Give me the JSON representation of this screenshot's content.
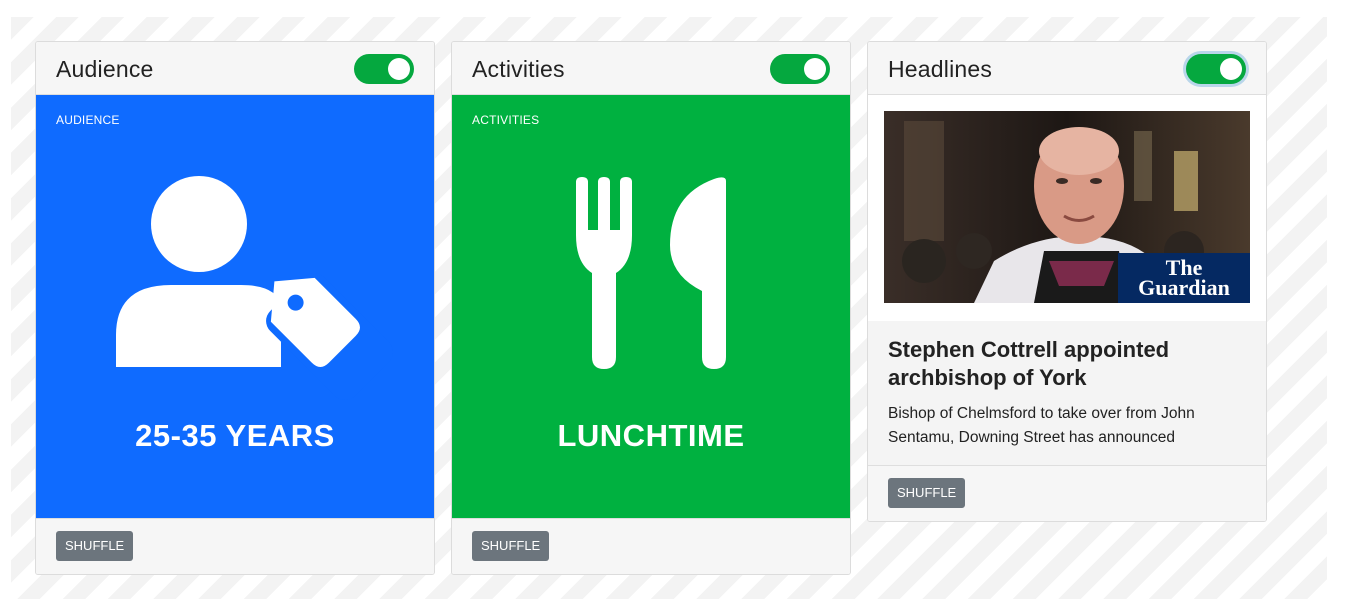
{
  "cards": [
    {
      "title": "Audience",
      "toggle_on": true,
      "tile_label": "AUDIENCE",
      "tile_value": "25-35 YEARS",
      "tile_color": "#0f6bff",
      "icon": "user-tag-icon",
      "shuffle_label": "SHUFFLE"
    },
    {
      "title": "Activities",
      "toggle_on": true,
      "tile_label": "ACTIVITIES",
      "tile_value": "LUNCHTIME",
      "tile_color": "#00b140",
      "icon": "fork-knife-icon",
      "shuffle_label": "SHUFFLE"
    },
    {
      "title": "Headlines",
      "toggle_on": true,
      "image_alt": "photo",
      "logo_text": "The Guardian",
      "headline": "Stephen Cottrell appointed archbishop of York",
      "description": "Bishop of Chelmsford to take over from John Sentamu, Downing Street has announced",
      "shuffle_label": "SHUFFLE"
    }
  ],
  "colors": {
    "toggle_on": "#05a83f",
    "button": "#6c757d"
  }
}
